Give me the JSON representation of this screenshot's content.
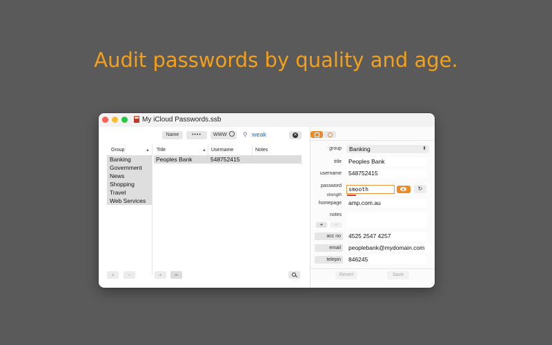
{
  "headline": "Audit passwords by quality and age.",
  "window": {
    "title": "My iCloud Passwords.ssb"
  },
  "toolbar": {
    "name_label": "Name",
    "password_mask": "••••",
    "www_label": "WWW",
    "search_value": "weak"
  },
  "groups": {
    "header": "Group",
    "items": [
      "Banking",
      "Government",
      "News",
      "Shopping",
      "Travel",
      "Web Services"
    ]
  },
  "entries": {
    "headers": {
      "title": "Title",
      "username": "Username",
      "notes": "Notes"
    },
    "rows": [
      {
        "title": "Peoples Bank",
        "username": "548752415",
        "notes": ""
      }
    ]
  },
  "bottom_buttons": {
    "add": "+",
    "remove": "−"
  },
  "detail": {
    "fields": {
      "group_label": "group",
      "group_value": "Banking",
      "title_label": "title",
      "title_value": "Peoples Bank",
      "username_label": "username",
      "username_value": "548752415",
      "password_label": "password",
      "password_value": "smooth",
      "strength_label": "strength",
      "homepage_label": "homepage",
      "homepage_value": "amp.com.au",
      "notes_label": "notes",
      "notes_value": ""
    },
    "custom_fields": [
      {
        "label": "acc no",
        "value": "4525 2547 4257"
      },
      {
        "label": "email",
        "value": "peoplebank@mydomain.com"
      },
      {
        "label": "telepin",
        "value": "846245"
      }
    ],
    "revert_label": "Revert",
    "save_label": "Save",
    "strength_color": "#e53a2c"
  },
  "colors": {
    "accent": "#f08a24",
    "headline": "#f5a019",
    "background": "#5a5a5a"
  }
}
